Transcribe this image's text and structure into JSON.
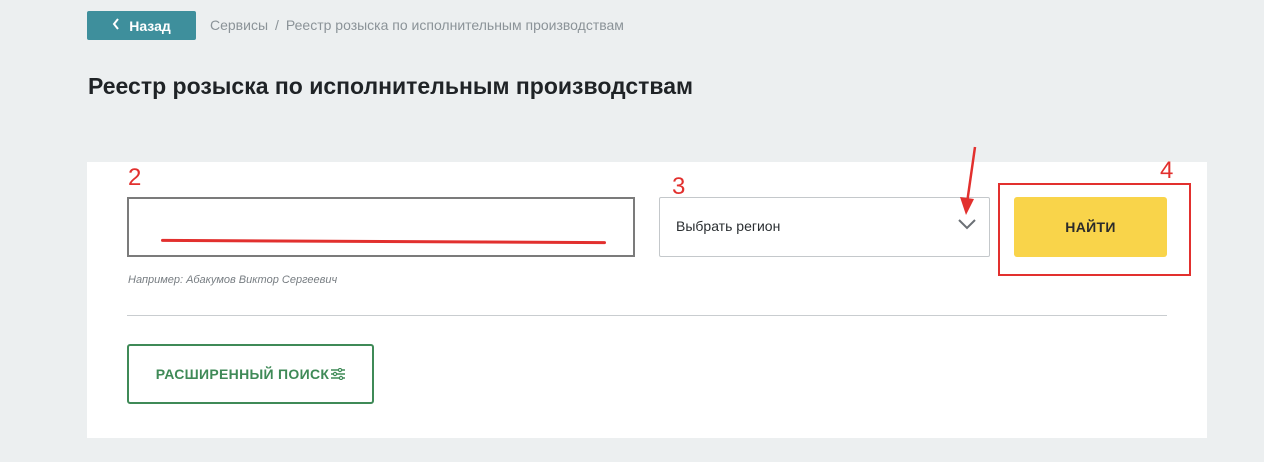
{
  "nav": {
    "back_label": "Назад",
    "back_icon": "chevron-left-icon",
    "breadcrumb": [
      "Сервисы",
      "Реестр розыска по исполнительным производствам"
    ],
    "separator": "/"
  },
  "page": {
    "title": "Реестр розыска по исполнительным производствам"
  },
  "form": {
    "name_input": {
      "value": "",
      "placeholder": ""
    },
    "hint": "Например: Абакумов Виктор Сергеевич",
    "region_select": {
      "selected": "Выбрать регион",
      "icon": "chevron-down-icon"
    },
    "search_button_label": "НАЙТИ",
    "advanced_search_label": "РАСШИРЕННЫЙ ПОИСК",
    "advanced_search_icon": "filter-sliders-icon"
  },
  "annotations": {
    "label_2": "2",
    "label_3": "3",
    "label_4": "4"
  },
  "colors": {
    "accent_teal": "#3e8f9c",
    "search_yellow": "#f9d44a",
    "advanced_green": "#3f8a57",
    "annotation_red": "#e2302e"
  }
}
